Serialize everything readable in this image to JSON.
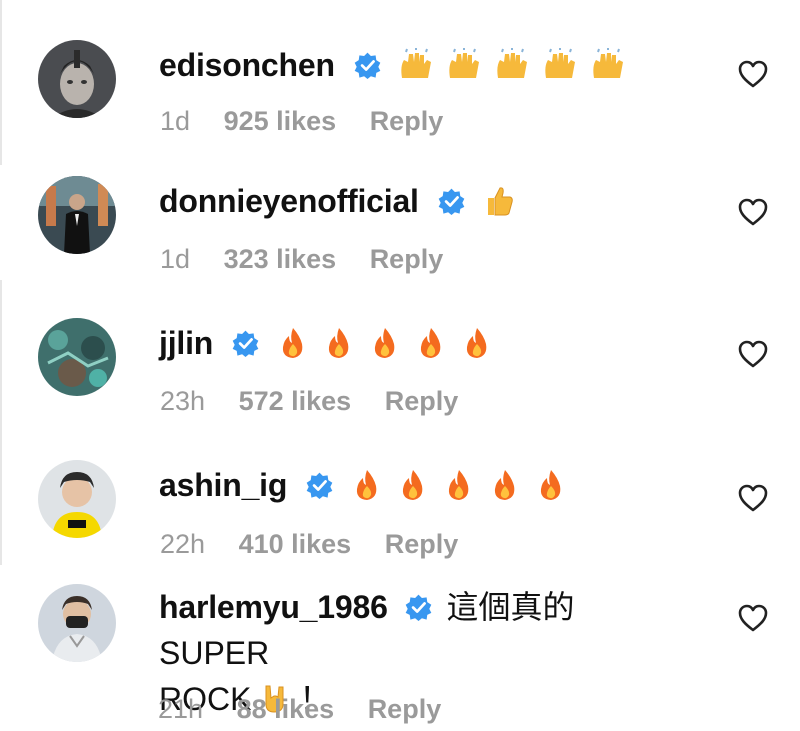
{
  "comments": [
    {
      "username": "edisonchen",
      "emoji": "🙌🙌🙌🙌🙌",
      "time": "1d",
      "likes": "925 likes",
      "reply": "Reply",
      "emoji_icons": [
        "raising-hands",
        "raising-hands",
        "raising-hands",
        "raising-hands",
        "raising-hands"
      ]
    },
    {
      "username": "donnieyenofficial",
      "emoji": "👍",
      "time": "1d",
      "likes": "323 likes",
      "reply": "Reply",
      "emoji_icons": [
        "thumbs-up"
      ]
    },
    {
      "username": "jjlin",
      "emoji": "🔥🔥🔥🔥🔥",
      "time": "23h",
      "likes": "572 likes",
      "reply": "Reply",
      "emoji_icons": [
        "fire",
        "fire",
        "fire",
        "fire",
        "fire"
      ]
    },
    {
      "username": "ashin_ig",
      "emoji": "🔥🔥🔥🔥🔥",
      "time": "22h",
      "likes": "410 likes",
      "reply": "Reply",
      "emoji_icons": [
        "fire",
        "fire",
        "fire",
        "fire",
        "fire"
      ]
    },
    {
      "username": "harlemyu_1986",
      "text_part1": "這個真的SUPER",
      "text_part2": "ROCK",
      "emoji": "🤘",
      "text_part3": "！",
      "time": "21h",
      "likes": "88 likes",
      "reply": "Reply",
      "emoji_icons": [
        "rock-on"
      ]
    }
  ],
  "colors": {
    "verified": "#3897f0",
    "meta": "#9a9a9a",
    "text": "#111111",
    "fire": "#f46b1f",
    "hands": "#f6b93b"
  }
}
